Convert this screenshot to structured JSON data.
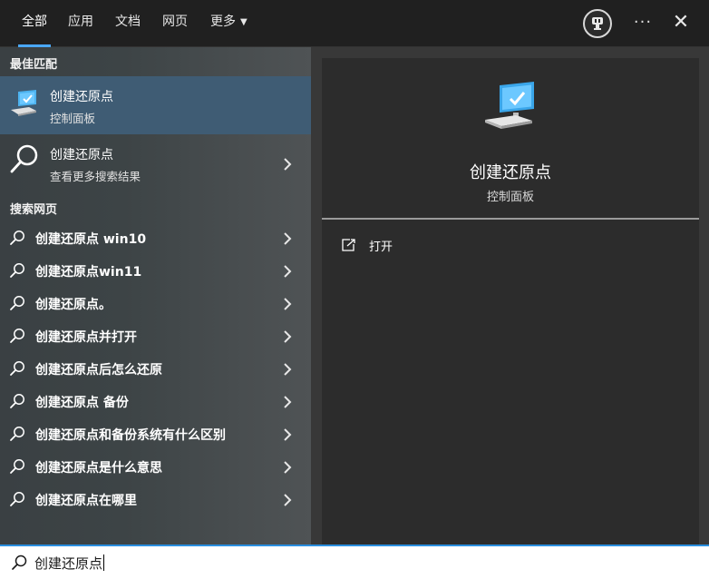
{
  "tabs": [
    {
      "label": "全部",
      "active": true
    },
    {
      "label": "应用"
    },
    {
      "label": "文档"
    },
    {
      "label": "网页"
    },
    {
      "label": "更多"
    }
  ],
  "topbar": {
    "avatar_icon": "user-avatar-icon",
    "more_label": "···",
    "close_label": "✕"
  },
  "left": {
    "best_match_title": "最佳匹配",
    "best_match": {
      "title": "创建还原点",
      "subtitle": "控制面板",
      "icon": "computer-checkmark-icon"
    },
    "more_results": {
      "title": "创建还原点",
      "subtitle": "查看更多搜索结果",
      "icon": "search-icon"
    },
    "web_title": "搜索网页",
    "web_items": [
      {
        "label": "创建还原点 win10"
      },
      {
        "label": "创建还原点win11"
      },
      {
        "label": "创建还原点。"
      },
      {
        "label": "创建还原点并打开"
      },
      {
        "label": "创建还原点后怎么还原"
      },
      {
        "label": "创建还原点 备份"
      },
      {
        "label": "创建还原点和备份系统有什么区别"
      },
      {
        "label": "创建还原点是什么意思"
      },
      {
        "label": "创建还原点在哪里"
      }
    ]
  },
  "right": {
    "title": "创建还原点",
    "subtitle": "控制面板",
    "icon": "computer-checkmark-icon",
    "action_label": "打开",
    "action_icon": "open-icon"
  },
  "search": {
    "value": "创建还原点",
    "icon": "search-icon"
  },
  "colors": {
    "accent": "#4aa8ff",
    "selected_row": "#3f5c74",
    "search_border": "#2a8fe0"
  }
}
